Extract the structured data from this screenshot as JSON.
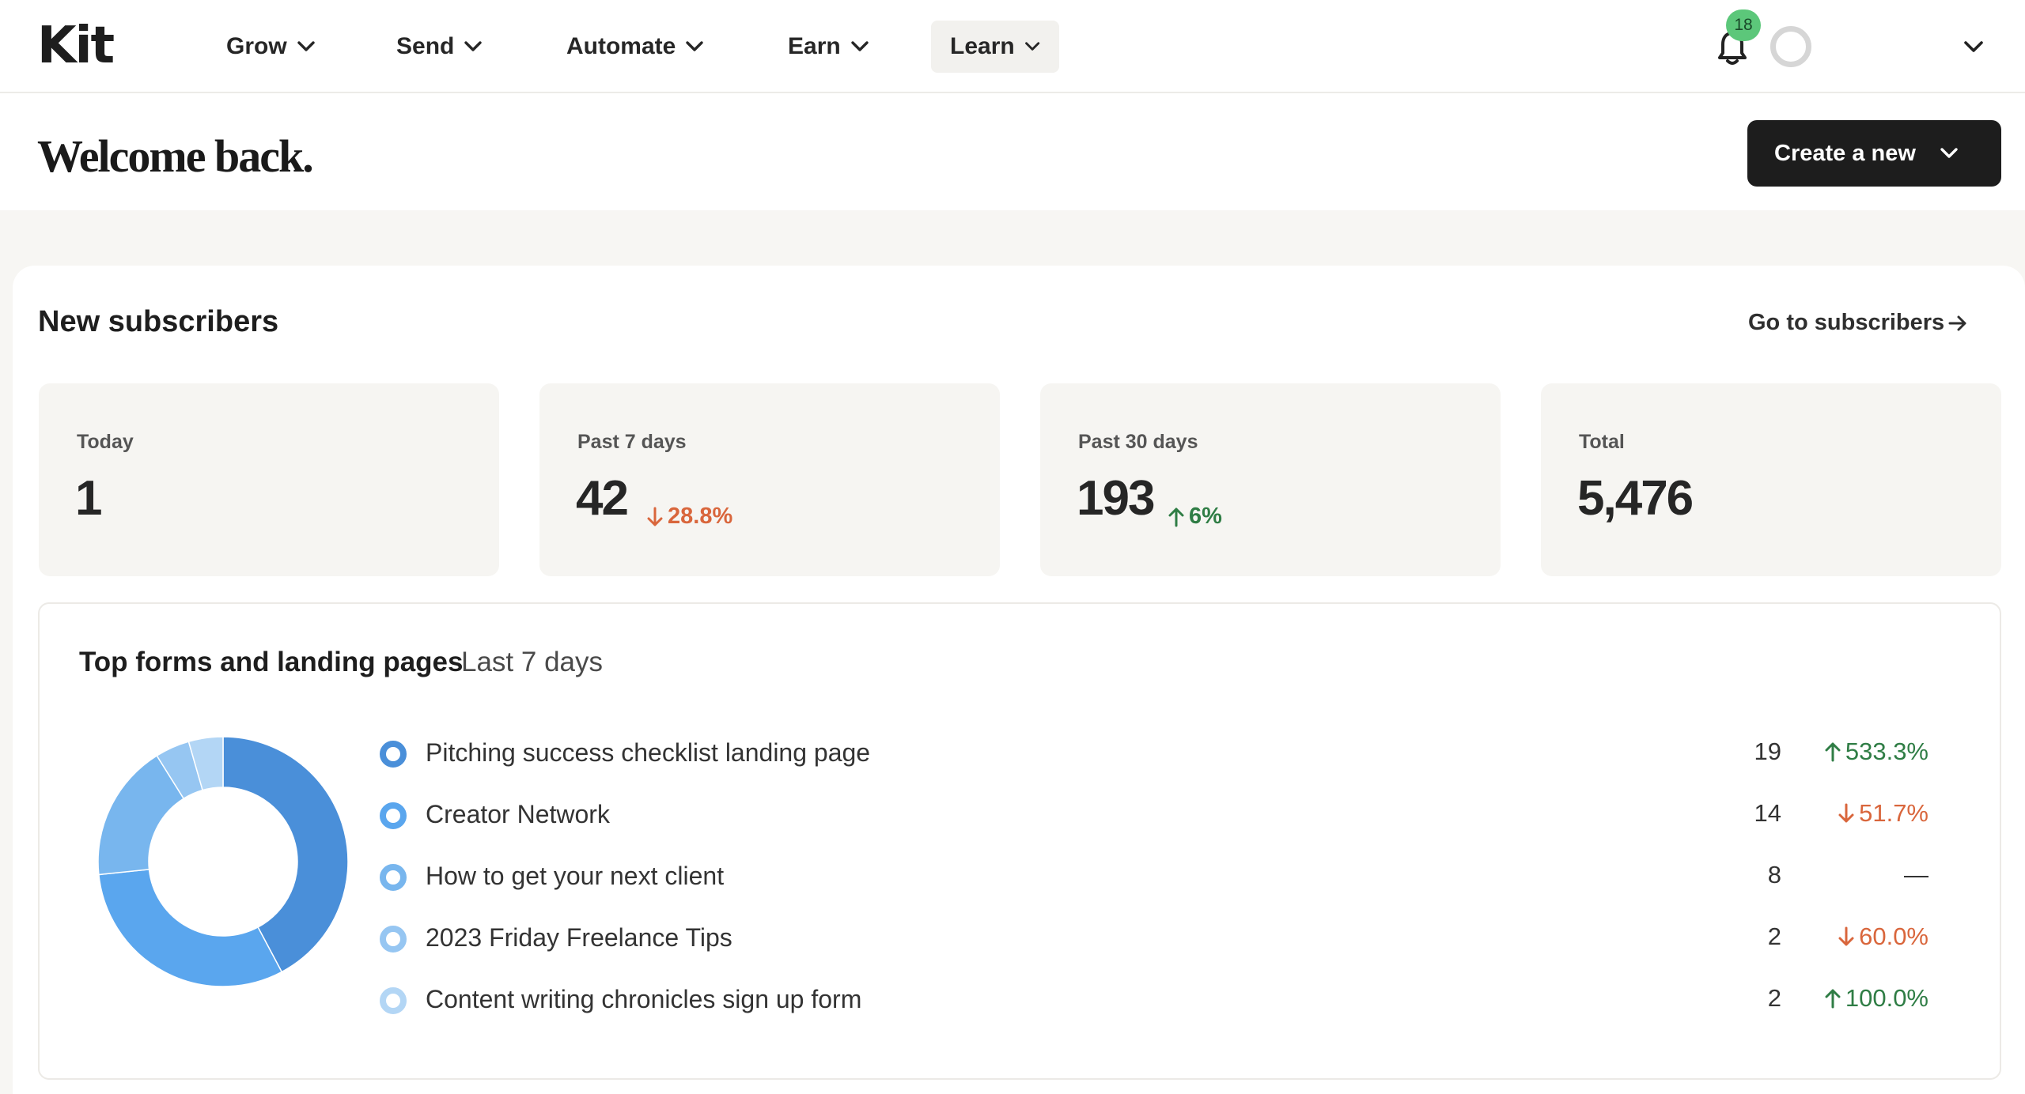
{
  "nav": {
    "logo": "Kit",
    "items": [
      {
        "label": "Grow"
      },
      {
        "label": "Send"
      },
      {
        "label": "Automate"
      },
      {
        "label": "Earn"
      },
      {
        "label": "Learn",
        "active": true
      }
    ],
    "notification_count": "18"
  },
  "header": {
    "title": "Welcome back.",
    "create_button": "Create a new"
  },
  "subscribers": {
    "title": "New subscribers",
    "link": "Go to subscribers",
    "stats": [
      {
        "label": "Today",
        "value": "1",
        "change": ""
      },
      {
        "label": "Past 7 days",
        "value": "42",
        "change": "28.8%",
        "direction": "down"
      },
      {
        "label": "Past 30 days",
        "value": "193",
        "change": "6%",
        "direction": "up"
      },
      {
        "label": "Total",
        "value": "5,476",
        "change": ""
      }
    ]
  },
  "forms": {
    "title": "Top forms and landing pages",
    "range": "Last 7 days",
    "items": [
      {
        "label": "Pitching success checklist landing page",
        "count": "19",
        "change": "533.3%",
        "direction": "up",
        "color": "#4a8fd9"
      },
      {
        "label": "Creator Network",
        "count": "14",
        "change": "51.7%",
        "direction": "down",
        "color": "#5aa6ee"
      },
      {
        "label": "How to get your next client",
        "count": "8",
        "change": "—",
        "direction": "none",
        "color": "#78b6ee"
      },
      {
        "label": "2023 Friday Freelance Tips",
        "count": "2",
        "change": "60.0%",
        "direction": "down",
        "color": "#96c6f2"
      },
      {
        "label": "Content writing chronicles sign up form",
        "count": "2",
        "change": "100.0%",
        "direction": "up",
        "color": "#b3d6f5"
      }
    ]
  },
  "colors": {
    "up": "#2f7d45",
    "down": "#d9663c",
    "badge": "#5cc77a"
  }
}
